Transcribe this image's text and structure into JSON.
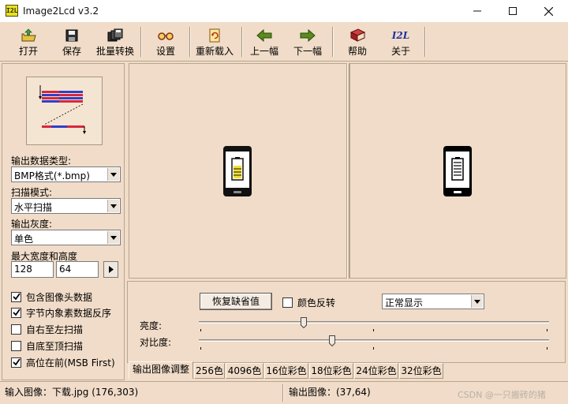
{
  "window": {
    "title": "Image2Lcd v3.2",
    "app_icon_text": "I2L"
  },
  "toolbar": {
    "open": "打开",
    "save": "保存",
    "batch": "批量转换",
    "settings": "设置",
    "reload": "重新载入",
    "prev": "上一幅",
    "next": "下一幅",
    "help": "帮助",
    "about": "关于",
    "about_icon_text": "I2L"
  },
  "left": {
    "output_type_label": "输出数据类型:",
    "output_type_value": "BMP格式(*.bmp)",
    "scan_mode_label": "扫描模式:",
    "scan_mode_value": "水平扫描",
    "gray_label": "输出灰度:",
    "gray_value": "单色",
    "size_label": "最大宽度和高度",
    "max_width": "128",
    "max_height": "64",
    "checks": [
      {
        "label": "包含图像头数据",
        "checked": true
      },
      {
        "label": "字节内象素数据反序",
        "checked": true
      },
      {
        "label": "自右至左扫描",
        "checked": false
      },
      {
        "label": "自底至顶扫描",
        "checked": false
      },
      {
        "label": "高位在前(MSB First)",
        "checked": true
      }
    ]
  },
  "adjust": {
    "restore_button": "恢复缺省值",
    "invert_label": "颜色反转",
    "invert_checked": false,
    "display_mode": "正常显示",
    "brightness_label": "亮度:",
    "contrast_label": "对比度:",
    "brightness_level": 0.3,
    "contrast_level": 0.38
  },
  "tabs": [
    "输出图像调整",
    "256色",
    "4096色",
    "16位彩色",
    "18位彩色",
    "24位彩色",
    "32位彩色"
  ],
  "active_tab": 0,
  "status": {
    "input": "输入图像：下载.jpg (176,303)",
    "output": "输出图像：(37,64)",
    "watermark": "CSDN @一只搬砖的猪"
  },
  "colors": {
    "background": "#f0dcc8",
    "battery_yellow": "#f2e030",
    "scan_red": "#d8283c",
    "scan_blue": "#3040c8"
  }
}
